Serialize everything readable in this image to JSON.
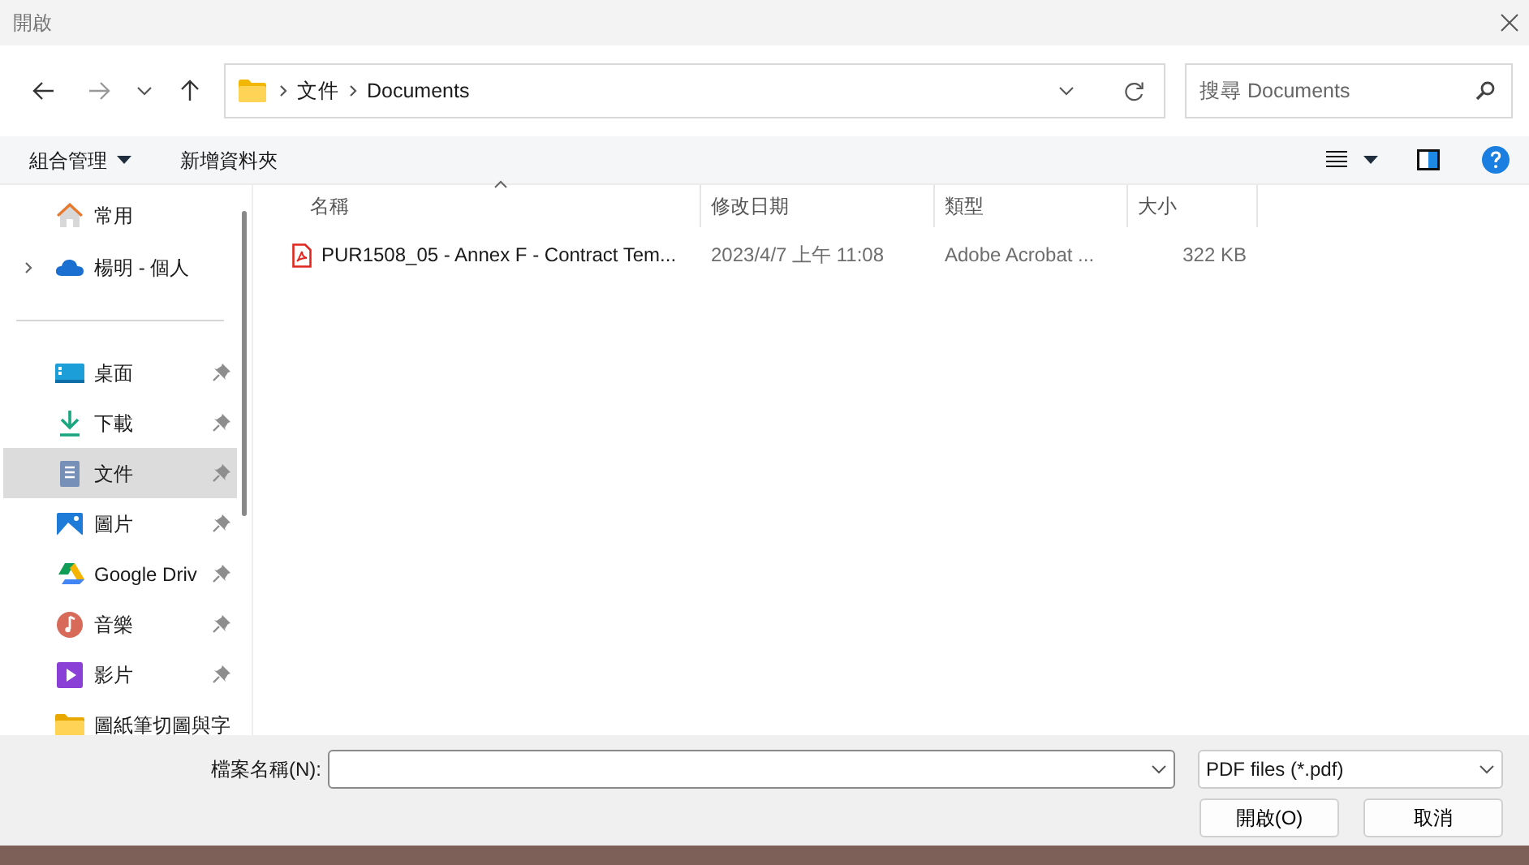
{
  "window": {
    "title": "開啟"
  },
  "navigation": {
    "path": [
      {
        "label": "文件"
      },
      {
        "label": "Documents"
      }
    ],
    "search": {
      "placeholder": "搜尋 Documents"
    }
  },
  "toolbar": {
    "organize": "組合管理",
    "new_folder": "新增資料夾"
  },
  "sidebar": {
    "groups": [
      [
        {
          "label": "常用",
          "kind": "home",
          "pinned": false,
          "selected": false
        },
        {
          "label": "楊明 - 個人",
          "kind": "cloud",
          "pinned": false,
          "selected": false,
          "expanded": false
        }
      ],
      [
        {
          "label": "桌面",
          "kind": "desktop",
          "pinned": true,
          "selected": false
        },
        {
          "label": "下載",
          "kind": "download",
          "pinned": true,
          "selected": false
        },
        {
          "label": "文件",
          "kind": "document",
          "pinned": true,
          "selected": true
        },
        {
          "label": "圖片",
          "kind": "pictures",
          "pinned": true,
          "selected": false
        },
        {
          "label": "Google Driv",
          "kind": "drive",
          "pinned": true,
          "selected": false
        },
        {
          "label": "音樂",
          "kind": "music",
          "pinned": true,
          "selected": false
        },
        {
          "label": "影片",
          "kind": "video",
          "pinned": true,
          "selected": false
        },
        {
          "label": "圖紙筆切圖與字",
          "kind": "folder",
          "pinned": false,
          "selected": false
        }
      ]
    ]
  },
  "file_list": {
    "columns": [
      {
        "label": "名稱",
        "sorted": true
      },
      {
        "label": "修改日期",
        "sorted": false
      },
      {
        "label": "類型",
        "sorted": false
      },
      {
        "label": "大小",
        "sorted": false
      }
    ],
    "rows": [
      {
        "name": "PUR1508_05 - Annex F - Contract Tem...",
        "modified": "2023/4/7 上午 11:08",
        "type": "Adobe Acrobat ...",
        "size": "322 KB"
      }
    ]
  },
  "footer": {
    "filename_label": "檔案名稱(N):",
    "file_type": "PDF files (*.pdf)",
    "buttons": [
      {
        "label": "開啟(O)"
      },
      {
        "label": "取消"
      }
    ]
  }
}
